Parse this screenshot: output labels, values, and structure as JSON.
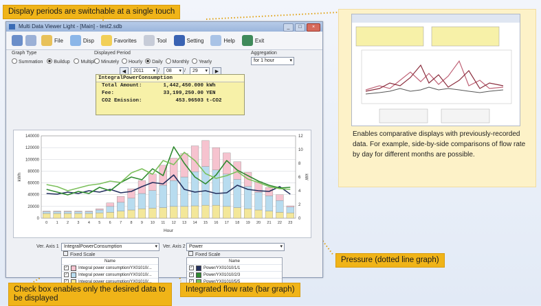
{
  "callouts": {
    "top": "Display periods are switchable at a single touch",
    "pressure": "Pressure (dotted line graph)",
    "checkbox": "Check box enables only the desired data to be displayed",
    "flow": "Integrated flow rate (bar graph)"
  },
  "panel": {
    "text": "Enables comparative displays with previously-recorded data. For example, side-by-side comparisons of flow rate by day for different months are possible."
  },
  "window": {
    "title": "Multi Data Viewer Light - [Main] - test2.sdb",
    "toolbar": [
      "File",
      "Disp",
      "Favorites",
      "Tool",
      "Setting",
      "Help",
      "Exit"
    ],
    "graph_type_label": "Graph Type",
    "graph_types": [
      "Summation",
      "Buildup",
      "Multiple"
    ],
    "graph_type_selected": "Buildup",
    "period_label": "Displayed Period",
    "periods": [
      "Minutely",
      "Hourly",
      "Daily",
      "Monthly",
      "Yearly"
    ],
    "period_selected": "Daily",
    "aggregation_label": "Aggregation",
    "aggregation_value": "for 1 hour",
    "year": "2011",
    "month": "08",
    "day": "29",
    "summary": {
      "title": "IntegralPowerConsumption",
      "rows": [
        {
          "k": "Total Amount:",
          "v": "1,442,450.000",
          "u": "kWh"
        },
        {
          "k": "Fee:",
          "v": "33,199,250.00",
          "u": "YEN"
        },
        {
          "k": "CO2 Emission:",
          "v": "453.96503",
          "u": "t-CO2"
        }
      ]
    },
    "ver_axis1_label": "Ver. Axis 1",
    "ver_axis1_value": "IntegralPowerConsumption",
    "ver_axis2_label": "Ver. Axis 2",
    "ver_axis2_value": "Power",
    "fixed_scale": "Fixed Scale",
    "name_header": "Name",
    "legend1": [
      "Integral power consumption/YX01010/...",
      "Integral power consumption/YX01010/...",
      "Integral power consumption/YX01010/..."
    ],
    "legend2": [
      "Power/YX01010/1/1",
      "Power/YX01010/2/3",
      "Power/YX01010/5/5"
    ],
    "colors": {
      "accent": "#f0b418",
      "pink": "#f6c3cf",
      "blue": "#b8dcef",
      "yellow": "#f3e79a",
      "green1": "#2f8a2f",
      "green2": "#7cc05c",
      "navy": "#24305e"
    }
  },
  "chart_data": {
    "type": "bar",
    "xlabel": "Hour",
    "ylabel": "kWh",
    "y2label": "kW",
    "ylim": [
      0,
      140000
    ],
    "y2lim": [
      0,
      12
    ],
    "yticks": [
      "0",
      "20000",
      "40000",
      "60000",
      "80000",
      "100000",
      "120000",
      "140000"
    ],
    "y2ticks": [
      "0",
      "2",
      "4",
      "6",
      "8",
      "10",
      "12"
    ],
    "categories": [
      "0",
      "1",
      "2",
      "3",
      "4",
      "5",
      "6",
      "7",
      "8",
      "9",
      "10",
      "11",
      "12",
      "13",
      "14",
      "15",
      "16",
      "17",
      "18",
      "19",
      "20",
      "21",
      "22",
      "23"
    ],
    "series": [
      {
        "kind": "bar-stack",
        "color": "#f3e79a",
        "values": [
          8000,
          8000,
          8000,
          8000,
          8000,
          9000,
          10000,
          12000,
          14000,
          16000,
          17000,
          18000,
          20000,
          20000,
          21000,
          22000,
          22000,
          20000,
          18000,
          16000,
          14000,
          12000,
          10000,
          9000
        ]
      },
      {
        "kind": "bar-stack",
        "color": "#b8dcef",
        "values": [
          3000,
          3000,
          3000,
          3000,
          3000,
          5000,
          10000,
          15000,
          20000,
          26000,
          30000,
          38000,
          44000,
          50000,
          58000,
          66000,
          60000,
          55000,
          48000,
          38000,
          30000,
          26000,
          20000,
          10000
        ]
      },
      {
        "kind": "bar-stack",
        "color": "#f6c3cf",
        "values": [
          1000,
          1000,
          1000,
          1000,
          1000,
          2000,
          6000,
          10000,
          16000,
          22000,
          28000,
          34000,
          38000,
          40000,
          44000,
          44000,
          38000,
          36000,
          30000,
          24000,
          18000,
          14000,
          10000,
          2000
        ]
      },
      {
        "kind": "line",
        "color": "#24305e",
        "values": [
          3.6,
          3.5,
          3.8,
          3.6,
          4.0,
          3.8,
          4.2,
          3.7,
          3.9,
          4.6,
          5.2,
          5.0,
          6.3,
          4.2,
          3.8,
          4.0,
          3.6,
          3.7,
          4.8,
          4.2,
          4.0,
          3.9,
          4.6,
          3.5
        ]
      },
      {
        "kind": "line",
        "color": "#2f8a2f",
        "values": [
          4.2,
          3.8,
          3.4,
          3.9,
          3.6,
          4.5,
          4.0,
          5.2,
          6.0,
          5.6,
          7.2,
          6.2,
          10.4,
          8.0,
          6.0,
          5.0,
          6.3,
          8.4,
          7.0,
          6.2,
          5.4,
          4.8,
          4.4,
          4.5
        ]
      },
      {
        "kind": "line",
        "color": "#7cc05c",
        "values": [
          4.9,
          4.6,
          4.0,
          4.4,
          4.8,
          5.0,
          5.4,
          5.2,
          6.6,
          7.2,
          6.4,
          8.4,
          7.8,
          9.6,
          8.4,
          6.5,
          5.8,
          6.2,
          6.8,
          5.7,
          5.2,
          4.6,
          4.3,
          4.2
        ]
      }
    ]
  }
}
